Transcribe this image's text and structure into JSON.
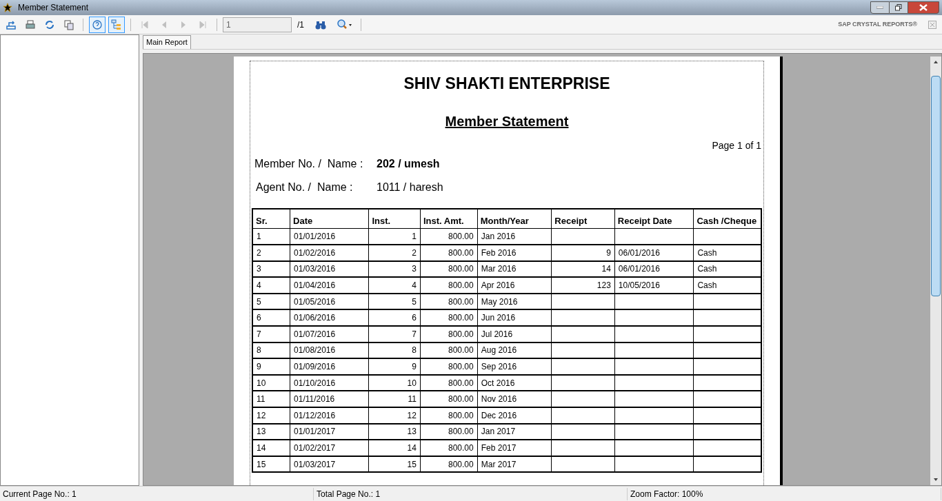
{
  "window": {
    "title": "Member Statement"
  },
  "toolbar": {
    "buttons": [
      {
        "kind": "export",
        "selected": false,
        "disabled": false
      },
      {
        "kind": "print",
        "selected": false,
        "disabled": false
      },
      {
        "kind": "refresh",
        "selected": false,
        "disabled": false
      },
      {
        "kind": "copy",
        "selected": false,
        "disabled": false
      },
      {
        "kind": "help",
        "selected": true,
        "disabled": false
      },
      {
        "kind": "tree",
        "selected": true,
        "disabled": false
      }
    ],
    "nav": [
      {
        "kind": "first",
        "disabled": true
      },
      {
        "kind": "prev",
        "disabled": true
      },
      {
        "kind": "next",
        "disabled": true
      },
      {
        "kind": "last",
        "disabled": true
      }
    ],
    "page_field": {
      "value": "1"
    },
    "page_total": "/1",
    "brand": "SAP CRYSTAL REPORTS®"
  },
  "tabs": [
    {
      "label": "Main Report",
      "selected": true
    }
  ],
  "report": {
    "company": "SHIV SHAKTI ENTERPRISE",
    "title": "Member Statement",
    "page": "Page 1 of 1",
    "member_label": "Member No. /  Name :",
    "member_value": "202 / umesh",
    "agent_label": "Agent No. /  Name :",
    "agent_value": "1011 / haresh",
    "columns": [
      "Sr.",
      "Date",
      "Inst.",
      "Inst. Amt.",
      "Month/Year",
      "Receipt",
      "Receipt Date",
      "Cash /Cheque"
    ],
    "rows": [
      [
        "1",
        "01/01/2016",
        "1",
        "800.00",
        "Jan 2016",
        "",
        "",
        ""
      ],
      [
        "2",
        "01/02/2016",
        "2",
        "800.00",
        "Feb 2016",
        "9",
        "06/01/2016",
        "Cash"
      ],
      [
        "3",
        "01/03/2016",
        "3",
        "800.00",
        "Mar 2016",
        "14",
        "06/01/2016",
        "Cash"
      ],
      [
        "4",
        "01/04/2016",
        "4",
        "800.00",
        "Apr 2016",
        "123",
        "10/05/2016",
        "Cash"
      ],
      [
        "5",
        "01/05/2016",
        "5",
        "800.00",
        "May 2016",
        "",
        "",
        ""
      ],
      [
        "6",
        "01/06/2016",
        "6",
        "800.00",
        "Jun 2016",
        "",
        "",
        ""
      ],
      [
        "7",
        "01/07/2016",
        "7",
        "800.00",
        "Jul 2016",
        "",
        "",
        ""
      ],
      [
        "8",
        "01/08/2016",
        "8",
        "800.00",
        "Aug 2016",
        "",
        "",
        ""
      ],
      [
        "9",
        "01/09/2016",
        "9",
        "800.00",
        "Sep 2016",
        "",
        "",
        ""
      ],
      [
        "10",
        "01/10/2016",
        "10",
        "800.00",
        "Oct 2016",
        "",
        "",
        ""
      ],
      [
        "11",
        "01/11/2016",
        "11",
        "800.00",
        "Nov 2016",
        "",
        "",
        ""
      ],
      [
        "12",
        "01/12/2016",
        "12",
        "800.00",
        "Dec 2016",
        "",
        "",
        ""
      ],
      [
        "13",
        "01/01/2017",
        "13",
        "800.00",
        "Jan 2017",
        "",
        "",
        ""
      ],
      [
        "14",
        "01/02/2017",
        "14",
        "800.00",
        "Feb 2017",
        "",
        "",
        ""
      ],
      [
        "15",
        "01/03/2017",
        "15",
        "800.00",
        "Mar 2017",
        "",
        "",
        ""
      ]
    ]
  },
  "status_bar": [
    "Current Page No.: 1",
    "Total Page No.: 1",
    "Zoom Factor: 100%"
  ]
}
